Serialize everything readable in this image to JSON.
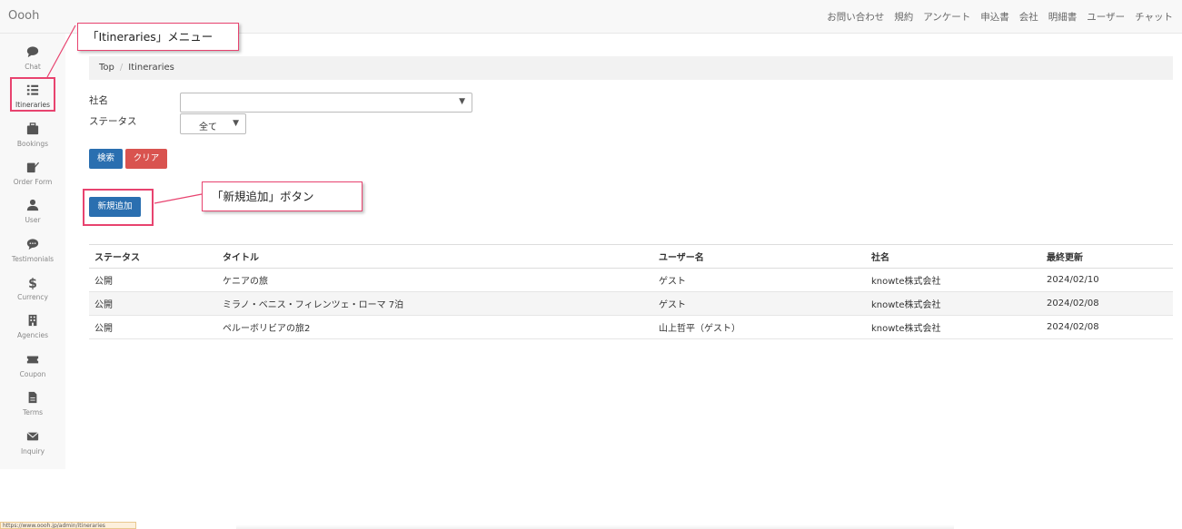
{
  "app": {
    "brand": "Oooh"
  },
  "topnav": [
    "お問い合わせ",
    "規約",
    "アンケート",
    "申込書",
    "会社",
    "明細書",
    "ユーザー",
    "チャット"
  ],
  "sidebar": {
    "items": [
      {
        "label": "Chat",
        "icon": "chat-icon"
      },
      {
        "label": "Itineraries",
        "icon": "list-icon",
        "active": true
      },
      {
        "label": "Bookings",
        "icon": "briefcase-icon"
      },
      {
        "label": "Order Form",
        "icon": "edit-icon"
      },
      {
        "label": "User",
        "icon": "user-icon"
      },
      {
        "label": "Testimonials",
        "icon": "comment-icon"
      },
      {
        "label": "Currency",
        "icon": "dollar-icon"
      },
      {
        "label": "Agencies",
        "icon": "building-icon"
      },
      {
        "label": "Coupon",
        "icon": "ticket-icon"
      },
      {
        "label": "Terms",
        "icon": "file-icon"
      },
      {
        "label": "Inquiry",
        "icon": "envelope-icon"
      }
    ]
  },
  "breadcrumb": {
    "home": "Top",
    "separator": "/",
    "current": "Itineraries"
  },
  "filters": {
    "company_label": "社名",
    "company_value": "",
    "status_label": "ステータス",
    "status_value": "全て"
  },
  "buttons": {
    "search": "検索",
    "clear": "クリア",
    "add_new": "新規追加"
  },
  "annotations": {
    "menu_callout": "「Itineraries」メニュー",
    "button_callout": "「新規追加」ボタン",
    "color": "#e8436f"
  },
  "table": {
    "headers": [
      "ステータス",
      "タイトル",
      "ユーザー名",
      "社名",
      "最終更新"
    ],
    "rows": [
      [
        "公開",
        "ケニアの旅",
        "ゲスト",
        "knowte株式会社",
        "2024/02/10"
      ],
      [
        "公開",
        "ミラノ・ベニス・フィレンツェ・ローマ 7泊",
        "ゲスト",
        "knowte株式会社",
        "2024/02/08"
      ],
      [
        "公開",
        "ペルーボリビアの旅2",
        "山上哲平（ゲスト）",
        "knowte株式会社",
        "2024/02/08"
      ]
    ]
  },
  "status_bar": {
    "url": "https://www.oooh.jp/admin/itineraries"
  },
  "colors": {
    "primary": "#2a6fb0",
    "danger": "#d9534f",
    "highlight": "#e8436f"
  }
}
